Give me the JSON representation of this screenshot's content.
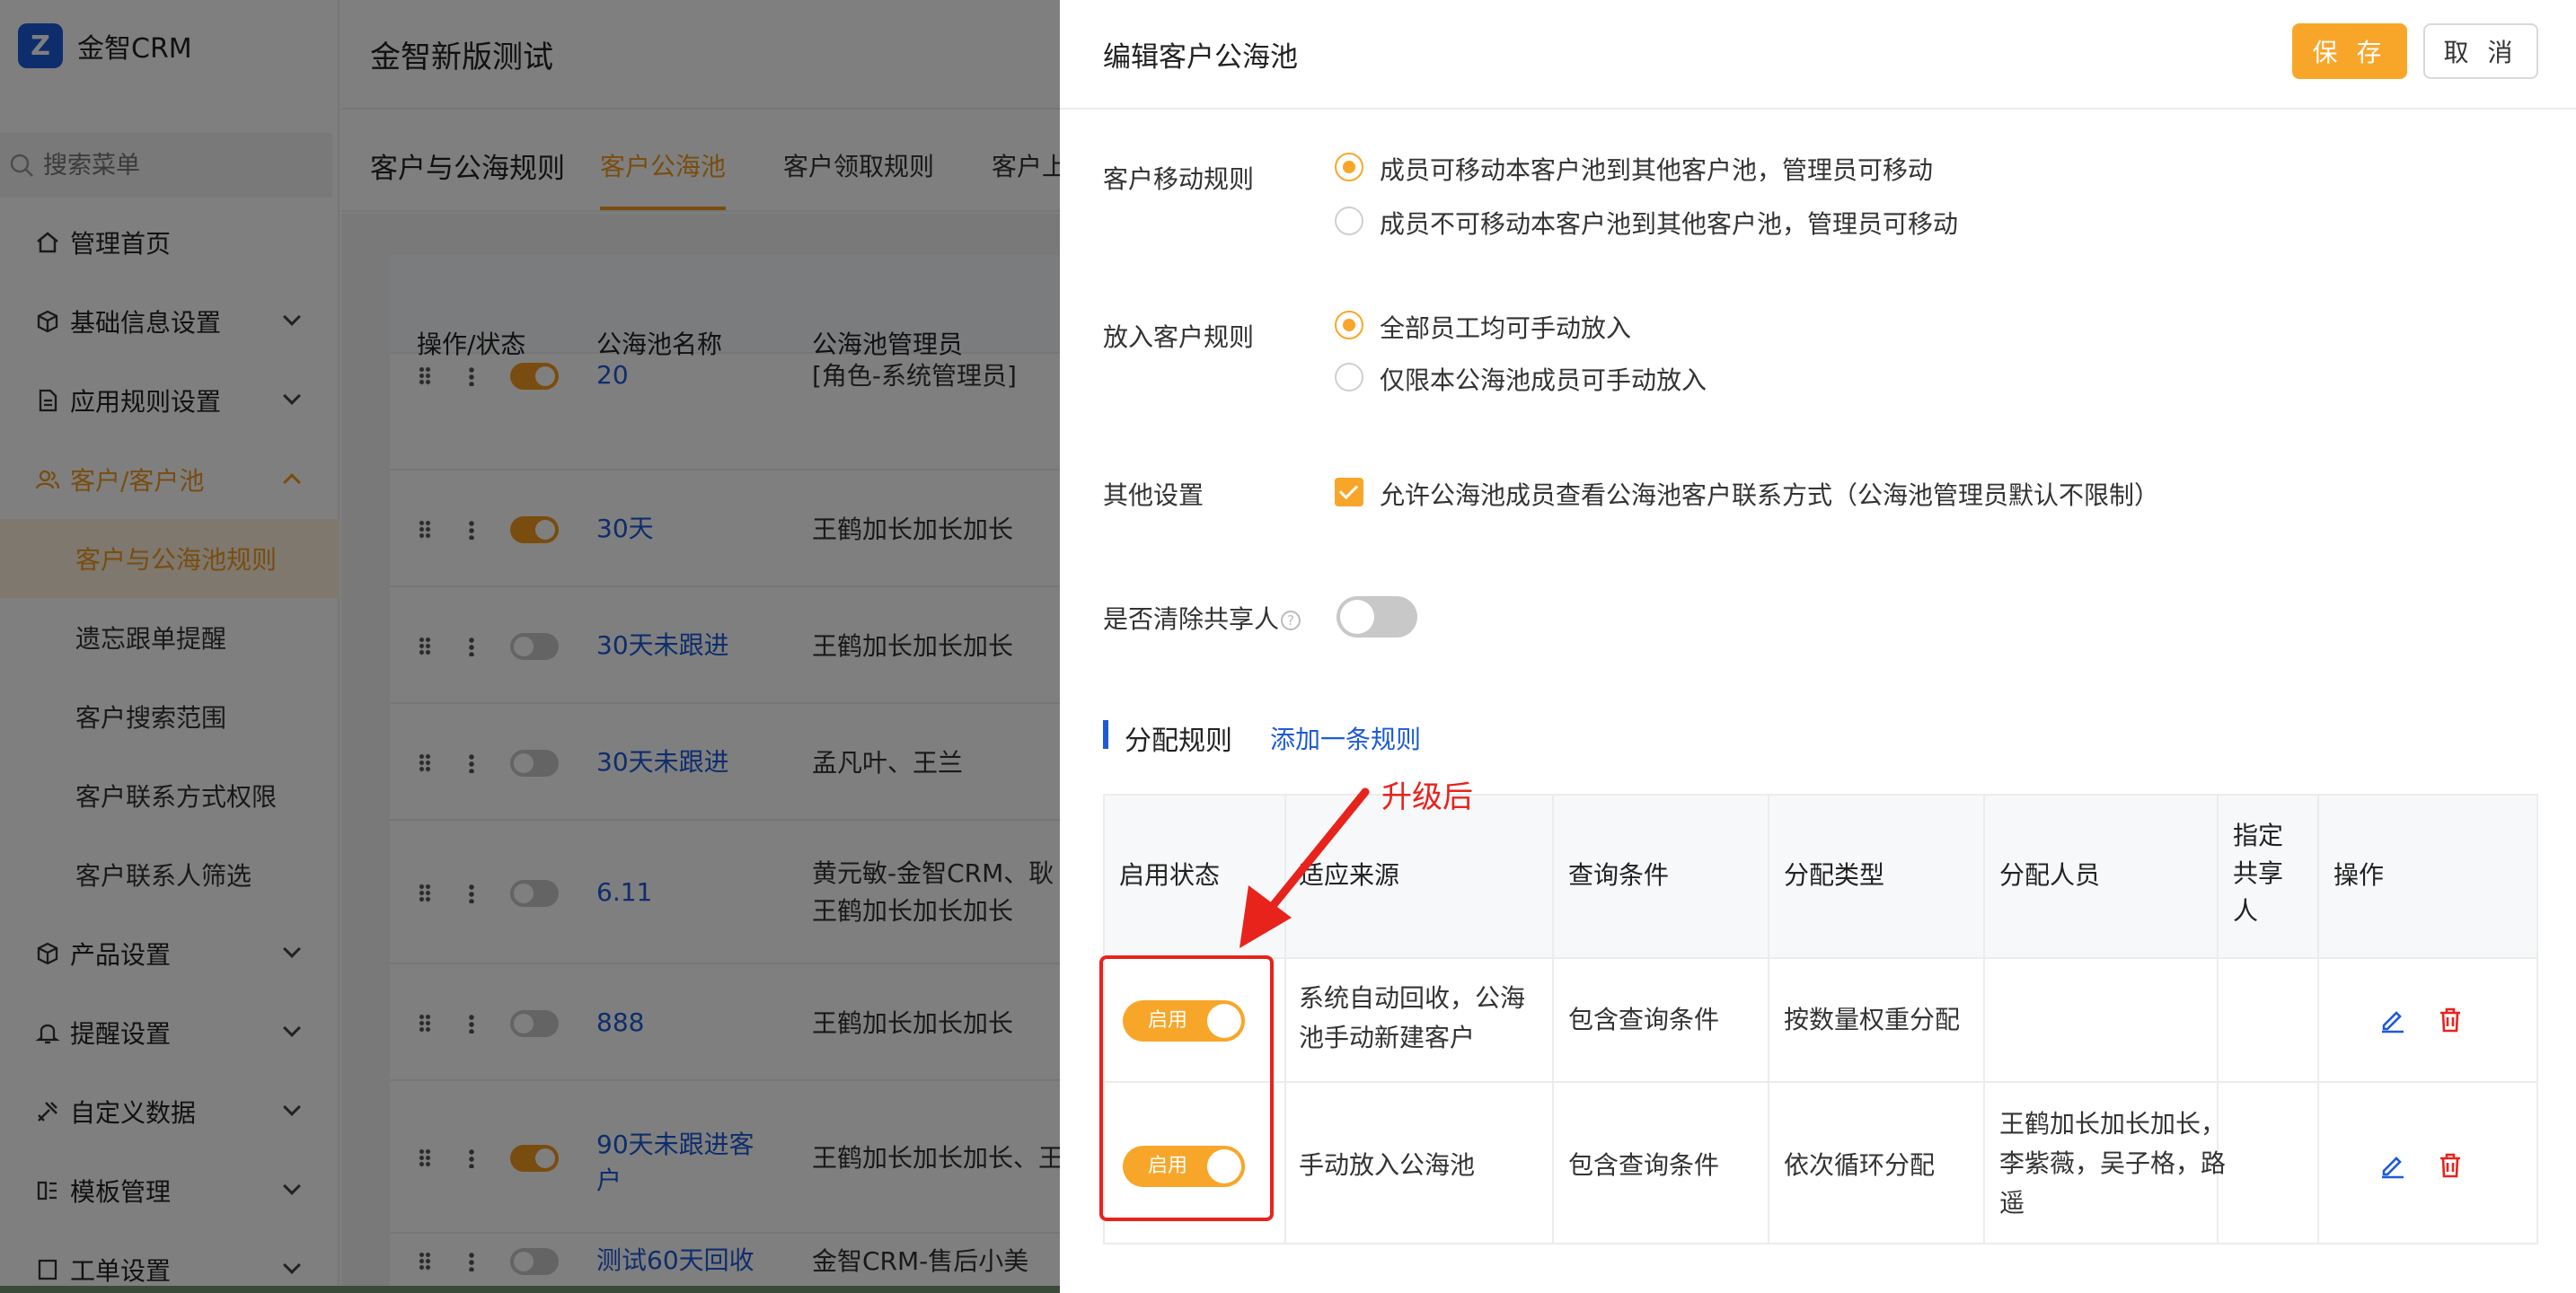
{
  "app": {
    "logo_letter": "Z",
    "name": "金智CRM",
    "project": "金智新版测试"
  },
  "search": {
    "placeholder": "搜索菜单"
  },
  "menu": [
    {
      "label": "管理首页",
      "icon": "home-icon"
    },
    {
      "label": "基础信息设置",
      "icon": "cube-icon"
    },
    {
      "label": "应用规则设置",
      "icon": "document-icon"
    },
    {
      "label": "客户/客户池",
      "icon": "user-group-icon"
    },
    {
      "label": "产品设置",
      "icon": "cube-icon"
    },
    {
      "label": "提醒设置",
      "icon": "bell-icon"
    },
    {
      "label": "自定义数据",
      "icon": "tools-icon"
    },
    {
      "label": "模板管理",
      "icon": "template-icon"
    },
    {
      "label": "工单设置",
      "icon": "ticket-icon"
    }
  ],
  "submenu": [
    "客户与公海池规则",
    "遗忘跟单提醒",
    "客户搜索范围",
    "客户联系方式权限",
    "客户联系人筛选"
  ],
  "page": {
    "title": "客户与公海规则",
    "tabs": [
      "客户公海池",
      "客户领取规则",
      "客户上"
    ]
  },
  "pool_table": {
    "headers": [
      "操作/状态",
      "公海池名称",
      "公海池管理员"
    ],
    "rows": [
      {
        "name": "20",
        "manager": "[角色-系统管理员]",
        "enabled": true
      },
      {
        "name": "30天",
        "manager": "王鹤加长加长加长",
        "enabled": true
      },
      {
        "name": "30天未跟进",
        "manager": "王鹤加长加长加长",
        "enabled": false
      },
      {
        "name": "30天未跟进",
        "manager": "孟凡叶、王兰",
        "enabled": false
      },
      {
        "name": "6.11",
        "manager": "黄元敏-金智CRM、耿",
        "manager2": "王鹤加长加长加长",
        "enabled": false
      },
      {
        "name": "888",
        "manager": "王鹤加长加长加长",
        "enabled": false
      },
      {
        "name": "90天未跟进客",
        "name2": "户",
        "manager": "王鹤加长加长加长、王",
        "enabled": true
      },
      {
        "name": "测试60天回收",
        "manager": "金智CRM-售后小美",
        "enabled": false
      }
    ]
  },
  "drawer": {
    "title": "编辑客户公海池",
    "save": "保 存",
    "cancel": "取 消",
    "move_rule": {
      "label": "客户移动规则",
      "options": [
        "成员可移动本客户池到其他客户池，管理员可移动",
        "成员不可移动本客户池到其他客户池，管理员可移动"
      ],
      "selected": 0
    },
    "put_rule": {
      "label": "放入客户规则",
      "options": [
        "全部员工均可手动放入",
        "仅限本公海池成员可手动放入"
      ],
      "selected": 0
    },
    "other": {
      "label": "其他设置",
      "checkbox": "允许公海池成员查看公海池客户联系方式（公海池管理员默认不限制）",
      "checked": true
    },
    "clear_share": {
      "label": "是否清除共享人",
      "help": "?",
      "enabled": false
    },
    "section": {
      "title": "分配规则",
      "add_link": "添加一条规则"
    },
    "rule_table": {
      "headers": [
        "启用状态",
        "适应来源",
        "查询条件",
        "分配类型",
        "分配人员",
        "指定共享人",
        "操作"
      ],
      "header_share_lines": [
        "指定",
        "共享",
        "人"
      ],
      "rows": [
        {
          "status": "启用",
          "source_l1": "系统自动回收，公海",
          "source_l2": "池手动新建客户",
          "query": "包含查询条件",
          "type": "按数量权重分配",
          "people_l1": "",
          "people_l2": "",
          "people_l3": ""
        },
        {
          "status": "启用",
          "source_l1": "手动放入公海池",
          "source_l2": "",
          "query": "包含查询条件",
          "type": "依次循环分配",
          "people_l1": "王鹤加长加长加长，",
          "people_l2": "李紫薇，吴子格，路",
          "people_l3": "遥"
        }
      ]
    }
  },
  "annotation": {
    "text": "升级后",
    "color": "#e8231c"
  },
  "colors": {
    "accent": "#f8a629",
    "link": "#1c5ad8",
    "danger": "#e8231c"
  }
}
